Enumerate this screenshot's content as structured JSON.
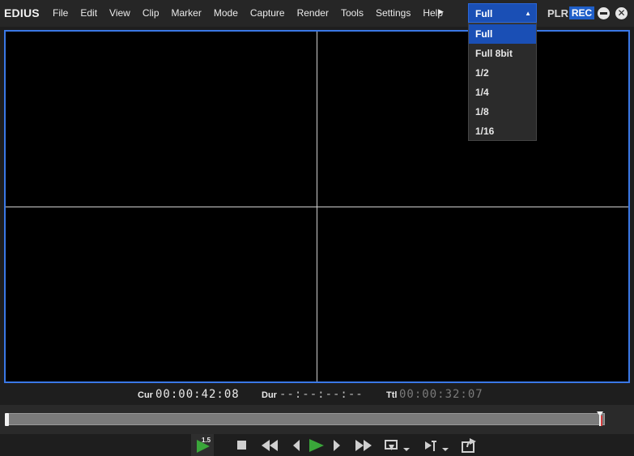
{
  "app": {
    "logo": "EDIUS"
  },
  "menu": [
    "File",
    "Edit",
    "View",
    "Clip",
    "Marker",
    "Mode",
    "Capture",
    "Render",
    "Tools",
    "Settings",
    "Help"
  ],
  "menu_more_icon": "right-triangle-icon",
  "quality": {
    "selected": "Full",
    "options": [
      "Full",
      "Full 8bit",
      "1/2",
      "1/4",
      "1/8",
      "1/16"
    ],
    "highlighted_index": 0
  },
  "mode_switch": {
    "plr": "PLR",
    "rec": "REC",
    "active": "REC"
  },
  "timecodes": {
    "cur_label": "Cur",
    "cur": "00:00:42:08",
    "dur_label": "Dur",
    "dur": "--:--:--:--",
    "ttl_label": "Ttl",
    "ttl": "00:00:32:07"
  },
  "shuttle_speed": "1.5",
  "colors": {
    "accent": "#1a4fb5",
    "play_green": "#3aa63a",
    "monitor_border": "#3a78e6"
  }
}
